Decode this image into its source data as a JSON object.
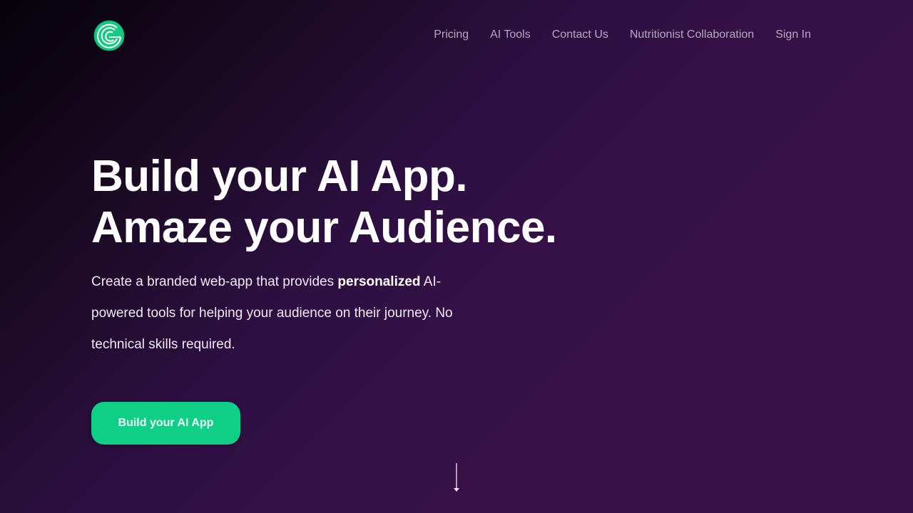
{
  "nav": {
    "logo_icon": "concentric-c-logo-icon",
    "links": [
      {
        "label": "Pricing"
      },
      {
        "label": "AI Tools"
      },
      {
        "label": "Contact Us"
      },
      {
        "label": "Nutritionist Collaboration"
      },
      {
        "label": "Sign In"
      }
    ]
  },
  "hero": {
    "title_line1": "Build your AI App.",
    "title_line2": "Amaze your Audience.",
    "desc_before": "Create a branded web-app that provides ",
    "desc_bold": "personalized",
    "desc_after": " AI-powered tools for helping your audience on their journey. No technical skills required.",
    "cta_label": "Build your AI App"
  },
  "scroll_indicator": {
    "icon": "arrow-down-icon"
  },
  "colors": {
    "brand_green": "#0fcf86",
    "background_dark": "#050208",
    "background_purple": "#391249",
    "nav_text": "#b8a8c4"
  }
}
